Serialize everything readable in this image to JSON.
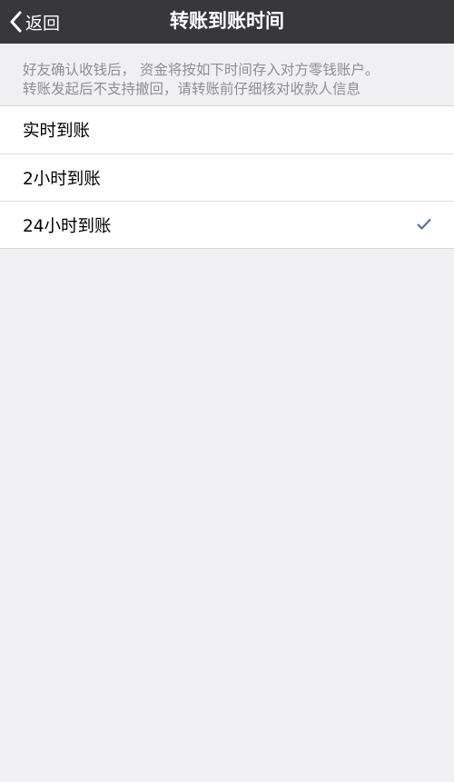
{
  "navbar": {
    "back_label": "返回",
    "title": "转账到账时间"
  },
  "notice": {
    "line1": "好友确认收钱后， 资金将按如下时间存入对方零钱账户。",
    "line2": "转账发起后不支持撤回，请转账前仔细核对收款人信息"
  },
  "options": [
    {
      "label": "实时到账",
      "selected": false
    },
    {
      "label": "2小时到账",
      "selected": false
    },
    {
      "label": "24小时到账",
      "selected": true
    }
  ],
  "colors": {
    "navbar_bg": "#38373c",
    "page_bg": "#efeff4",
    "check": "#4a6fa5"
  },
  "icons": {
    "back": "chevron-left-icon",
    "selected": "check-icon"
  }
}
